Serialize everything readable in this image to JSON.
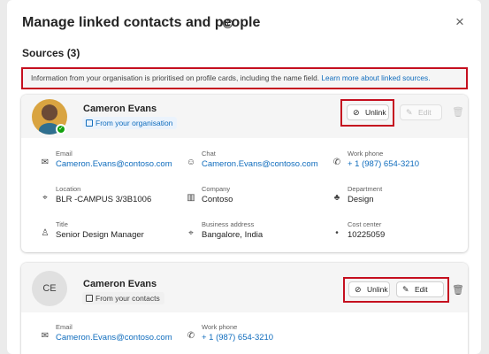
{
  "dialog": {
    "title": "Manage linked contacts and people",
    "info_glyph": "i",
    "close_glyph": "×",
    "sources_label": "Sources (3)",
    "banner": {
      "text": "Information from your organisation is prioritised on profile cards, including the name field.",
      "link": "Learn more about linked sources."
    }
  },
  "sources": [
    {
      "name": "Cameron Evans",
      "badge": "From your organisation",
      "avatar": "photo",
      "presence_glyph": "✓",
      "unlink_label": "Unlink",
      "edit_label": "Edit",
      "edit_disabled": true,
      "fields": [
        {
          "label": "Email",
          "value": "Cameron.Evans@contoso.com",
          "icon": "mail-icon",
          "glyph": "✉",
          "link": true
        },
        {
          "label": "Chat",
          "value": "Cameron.Evans@contoso.com",
          "icon": "chat-icon",
          "glyph": "☺",
          "link": true
        },
        {
          "label": "Work phone",
          "value": "+ 1 (987) 654-3210",
          "icon": "phone-icon",
          "glyph": "✆",
          "link": true
        },
        {
          "label": "Location",
          "value": "BLR -CAMPUS 3/3B1006",
          "icon": "location-icon",
          "glyph": "⌖",
          "link": false
        },
        {
          "label": "Company",
          "value": "Contoso",
          "icon": "building-icon",
          "glyph": "▥",
          "link": false
        },
        {
          "label": "Department",
          "value": "Design",
          "icon": "people-icon",
          "glyph": "♣",
          "link": false
        },
        {
          "label": "Title",
          "value": "Senior Design Manager",
          "icon": "person-icon",
          "glyph": "♙",
          "link": false
        },
        {
          "label": "Business address",
          "value": "Bangalore, India",
          "icon": "map-pin-icon",
          "glyph": "⌖",
          "link": false
        },
        {
          "label": "Cost  center",
          "value": "10225059",
          "icon": "cost-center-icon",
          "glyph": "•",
          "link": false
        }
      ]
    },
    {
      "name": "Cameron Evans",
      "badge": "From your contacts",
      "avatar": "initials",
      "initials": "CE",
      "unlink_label": "Unlink",
      "edit_label": "Edit",
      "edit_disabled": false,
      "fields": [
        {
          "label": "Email",
          "value": "Cameron.Evans@contoso.com",
          "icon": "mail-icon",
          "glyph": "✉",
          "link": true
        },
        {
          "label": "Work phone",
          "value": "+ 1 (987) 654-3210",
          "icon": "phone-icon",
          "glyph": "✆",
          "link": true
        }
      ]
    }
  ],
  "icons": {
    "unlink": "⊘",
    "edit": "✎",
    "trash": "🗑"
  },
  "colors": {
    "accent": "#0f6cbd",
    "highlight": "#c50f1f",
    "presence": "#13a10e"
  }
}
